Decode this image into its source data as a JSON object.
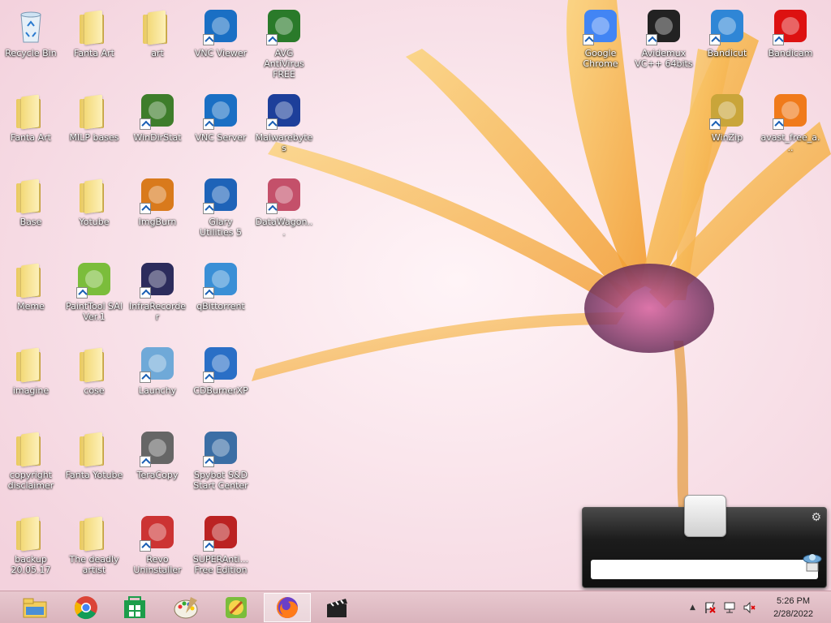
{
  "desktop": {
    "wallpaper": {
      "background": "#fbeaf0",
      "petal_color": "#f8b23c",
      "center_color": "#8e3f6e",
      "stem_color": "#e7a24a"
    },
    "icons": [
      {
        "label": "Recycle Bin",
        "icon": "recycle-bin-icon"
      },
      {
        "label": "Fanta Art",
        "icon": "folder-icon"
      },
      {
        "label": "art",
        "icon": "folder-icon"
      },
      {
        "label": "VNC Viewer",
        "icon": "vnc-viewer-icon"
      },
      {
        "label": "AVG AntiVirus FREE",
        "icon": "avg-icon"
      },
      {
        "label": "Fanta Art",
        "icon": "folder-icon"
      },
      {
        "label": "MILP bases",
        "icon": "folder-icon"
      },
      {
        "label": "WinDirStat",
        "icon": "windirstat-icon"
      },
      {
        "label": "VNC Server",
        "icon": "vnc-server-icon"
      },
      {
        "label": "Malwarebytes",
        "icon": "malwarebytes-icon"
      },
      {
        "label": "Base",
        "icon": "folder-icon"
      },
      {
        "label": "Yotube",
        "icon": "folder-icon"
      },
      {
        "label": "ImgBurn",
        "icon": "imgburn-icon"
      },
      {
        "label": "Glary Utilities 5",
        "icon": "glary-utilities-icon"
      },
      {
        "label": "DataWagon...",
        "icon": "datawagon-icon"
      },
      {
        "label": "Meme",
        "icon": "folder-icon"
      },
      {
        "label": "PaintTool SAI Ver.1",
        "icon": "painttool-sai-icon"
      },
      {
        "label": "InfraRecorder",
        "icon": "infrarecorder-icon"
      },
      {
        "label": "qBittorrent",
        "icon": "qbittorrent-icon"
      },
      {
        "label": "imagine",
        "icon": "folder-icon"
      },
      {
        "label": "cose",
        "icon": "folder-icon"
      },
      {
        "label": "Launchy",
        "icon": "launchy-icon"
      },
      {
        "label": "CDBurnerXP",
        "icon": "cdburnerxp-icon"
      },
      {
        "label": "copyright disclaimer",
        "icon": "folder-icon"
      },
      {
        "label": "Fanta Yotube",
        "icon": "folder-icon"
      },
      {
        "label": "TeraCopy",
        "icon": "teracopy-icon"
      },
      {
        "label": "Spybot S&D Start Center",
        "icon": "spybot-icon"
      },
      {
        "label": "backup 20.05.17",
        "icon": "folder-icon"
      },
      {
        "label": "The deadly artist",
        "icon": "folder-icon"
      },
      {
        "label": "Revo Uninstaller",
        "icon": "revo-uninstaller-icon"
      },
      {
        "label": "SUPERAnti... Free Edition",
        "icon": "superantispyware-icon"
      },
      {
        "label": "Google Chrome",
        "icon": "chrome-icon"
      },
      {
        "label": "Avidemux VC++ 64bits",
        "icon": "avidemux-icon"
      },
      {
        "label": "Bandicut",
        "icon": "bandicut-icon"
      },
      {
        "label": "Bandicam",
        "icon": "bandicam-icon"
      },
      {
        "label": "WinZip",
        "icon": "winzip-icon"
      },
      {
        "label": "avast_free_a...",
        "icon": "avast-icon"
      }
    ]
  },
  "taskbar": {
    "buttons": [
      {
        "name": "file-explorer",
        "icon": "file-explorer-icon",
        "active": false
      },
      {
        "name": "chrome",
        "icon": "chrome-icon",
        "active": false
      },
      {
        "name": "store",
        "icon": "store-icon",
        "active": false
      },
      {
        "name": "paint",
        "icon": "paint-icon",
        "active": false
      },
      {
        "name": "painttool-sai",
        "icon": "painttool-sai-icon",
        "active": false
      },
      {
        "name": "firefox",
        "icon": "firefox-icon",
        "active": true
      },
      {
        "name": "avidemux",
        "icon": "avidemux-icon",
        "active": false
      }
    ],
    "tray": {
      "show_hidden": "▲",
      "time": "5:26 PM",
      "date": "2/28/2022"
    }
  },
  "launchy_widget": {
    "input_value": "",
    "settings_icon": "gear-icon"
  }
}
